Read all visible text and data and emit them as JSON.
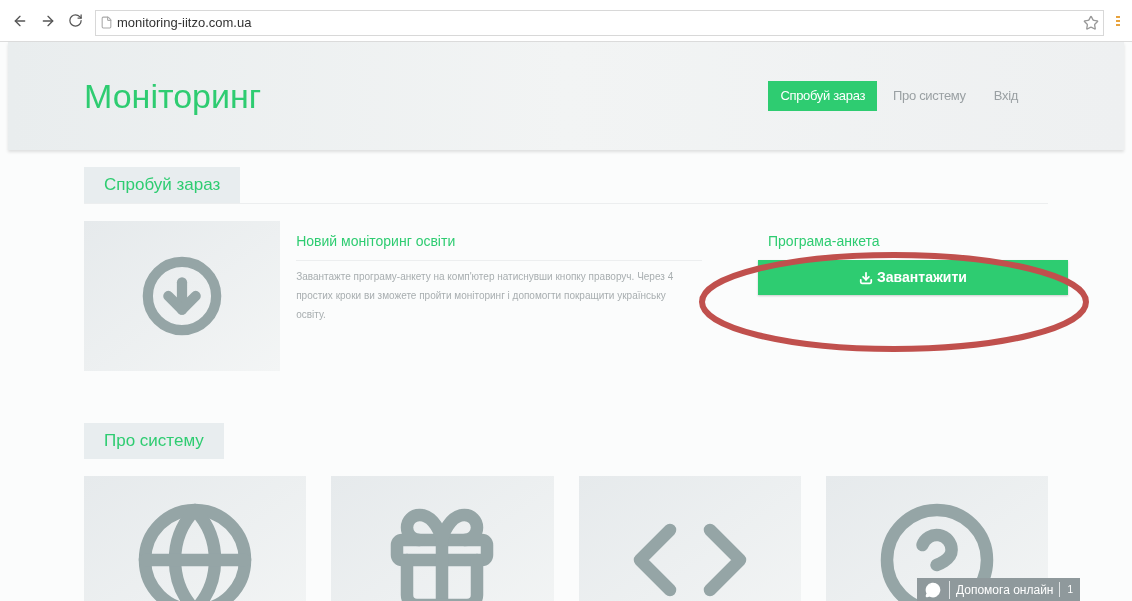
{
  "browser": {
    "url": "monitoring-iitzo.com.ua",
    "starred": false
  },
  "header": {
    "logo": "Моніторинг",
    "nav": [
      {
        "label": "Спробуй зараз",
        "selected": true
      },
      {
        "label": "Про систему",
        "selected": false
      },
      {
        "label": "Вхід",
        "selected": false
      }
    ]
  },
  "try_section": {
    "heading": "Спробуй зараз",
    "card": {
      "title": "Новий моніторинг освіти",
      "text": "Завантажте програму-анкету на комп'ютер натиснувши кнопку праворуч. Через 4 простих кроки ви зможете пройти моніторинг і допомогти покращити українську освіту.",
      "download_title": "Програма-анкета",
      "download_button": "Завантажити"
    }
  },
  "about_section": {
    "heading": "Про систему",
    "tiles": [
      {
        "kind": "globe"
      },
      {
        "kind": "gift"
      },
      {
        "kind": "code"
      },
      {
        "kind": "help"
      }
    ]
  },
  "chat_widget": {
    "label": "Допомога онлайн",
    "count": "1"
  },
  "annotation": {
    "kind": "ellipse",
    "color": "#c0504d"
  }
}
